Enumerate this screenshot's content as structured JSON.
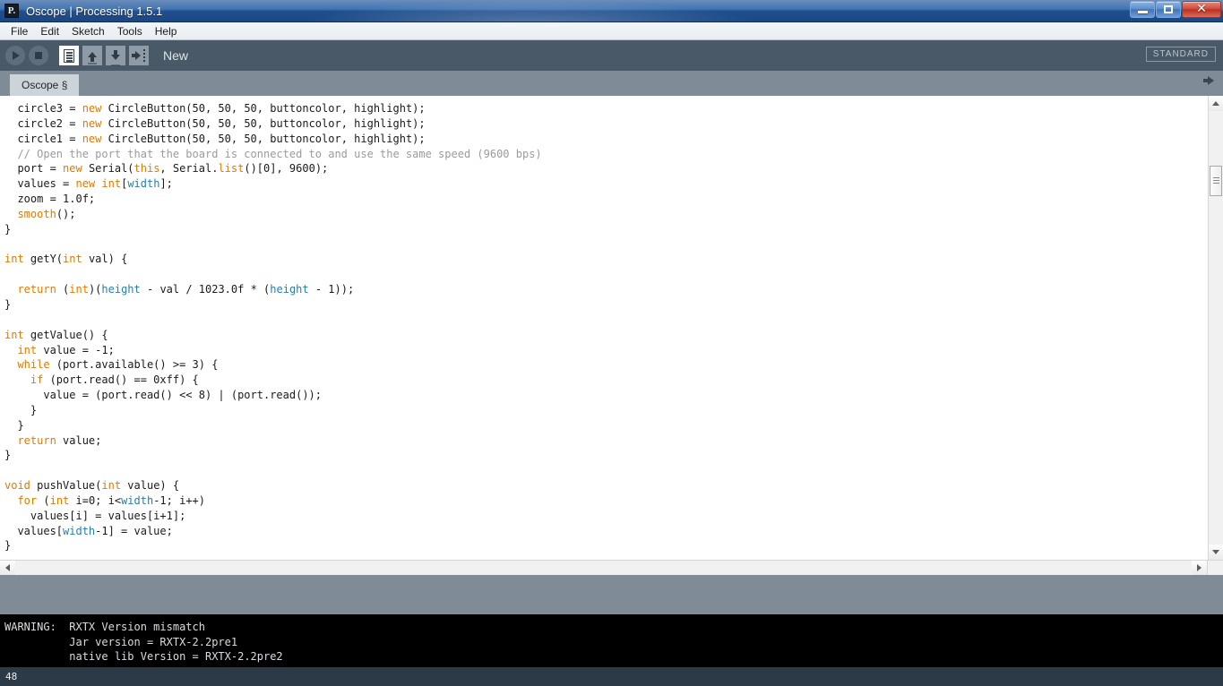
{
  "window": {
    "title": "Oscope | Processing 1.5.1",
    "app_icon": "P.",
    "minimize_label": "Minimize",
    "maximize_label": "Restore",
    "close_label": "✕"
  },
  "menubar": {
    "items": [
      {
        "label": "File"
      },
      {
        "label": "Edit"
      },
      {
        "label": "Sketch"
      },
      {
        "label": "Tools"
      },
      {
        "label": "Help"
      }
    ]
  },
  "toolbar": {
    "run_label": "Run",
    "stop_label": "Stop",
    "new_label": "New",
    "open_label": "Open",
    "save_label": "Save",
    "export_label": "Export",
    "status_text": "New",
    "mode_label": "STANDARD"
  },
  "tabbar": {
    "tabs": [
      {
        "label": "Oscope §"
      }
    ],
    "overflow_label": "More tabs"
  },
  "editor": {
    "lines": [
      [
        {
          "t": "  circle3 = ",
          "c": "lit"
        },
        {
          "t": "new",
          "c": "kw"
        },
        {
          "t": " CircleButton(50, 50, 50, buttoncolor, highlight);",
          "c": "lit"
        }
      ],
      [
        {
          "t": "  circle2 = ",
          "c": "lit"
        },
        {
          "t": "new",
          "c": "kw"
        },
        {
          "t": " CircleButton(50, 50, 50, buttoncolor, highlight);",
          "c": "lit"
        }
      ],
      [
        {
          "t": "  circle1 = ",
          "c": "lit"
        },
        {
          "t": "new",
          "c": "kw"
        },
        {
          "t": " CircleButton(50, 50, 50, buttoncolor, highlight);",
          "c": "lit"
        }
      ],
      [
        {
          "t": "  // Open the port that the board is connected to and use the same speed (9600 bps)",
          "c": "cm"
        }
      ],
      [
        {
          "t": "  port = ",
          "c": "lit"
        },
        {
          "t": "new",
          "c": "kw"
        },
        {
          "t": " Serial(",
          "c": "lit"
        },
        {
          "t": "this",
          "c": "kw"
        },
        {
          "t": ", Serial.",
          "c": "lit"
        },
        {
          "t": "list",
          "c": "fn"
        },
        {
          "t": "()[0], 9600);",
          "c": "lit"
        }
      ],
      [
        {
          "t": "  values = ",
          "c": "lit"
        },
        {
          "t": "new",
          "c": "kw"
        },
        {
          "t": " ",
          "c": "lit"
        },
        {
          "t": "int",
          "c": "kw"
        },
        {
          "t": "[",
          "c": "lit"
        },
        {
          "t": "width",
          "c": "var"
        },
        {
          "t": "];",
          "c": "lit"
        }
      ],
      [
        {
          "t": "  zoom = 1.0f;",
          "c": "lit"
        }
      ],
      [
        {
          "t": "  ",
          "c": "lit"
        },
        {
          "t": "smooth",
          "c": "fn"
        },
        {
          "t": "();",
          "c": "lit"
        }
      ],
      [
        {
          "t": "}",
          "c": "lit"
        }
      ],
      [
        {
          "t": "",
          "c": "lit"
        }
      ],
      [
        {
          "t": "int",
          "c": "kw"
        },
        {
          "t": " getY(",
          "c": "lit"
        },
        {
          "t": "int",
          "c": "kw"
        },
        {
          "t": " val) {",
          "c": "lit"
        }
      ],
      [
        {
          "t": "",
          "c": "lit"
        }
      ],
      [
        {
          "t": "  ",
          "c": "lit"
        },
        {
          "t": "return",
          "c": "kw"
        },
        {
          "t": " (",
          "c": "lit"
        },
        {
          "t": "int",
          "c": "kw"
        },
        {
          "t": ")(",
          "c": "lit"
        },
        {
          "t": "height",
          "c": "var"
        },
        {
          "t": " - val / 1023.0f * (",
          "c": "lit"
        },
        {
          "t": "height",
          "c": "var"
        },
        {
          "t": " - 1));",
          "c": "lit"
        }
      ],
      [
        {
          "t": "}",
          "c": "lit"
        }
      ],
      [
        {
          "t": "",
          "c": "lit"
        }
      ],
      [
        {
          "t": "int",
          "c": "kw"
        },
        {
          "t": " getValue() {",
          "c": "lit"
        }
      ],
      [
        {
          "t": "  ",
          "c": "lit"
        },
        {
          "t": "int",
          "c": "kw"
        },
        {
          "t": " value = -1;",
          "c": "lit"
        }
      ],
      [
        {
          "t": "  ",
          "c": "lit"
        },
        {
          "t": "while",
          "c": "kw"
        },
        {
          "t": " (port.available() >= 3) {",
          "c": "lit"
        }
      ],
      [
        {
          "t": "    ",
          "c": "lit"
        },
        {
          "t": "if",
          "c": "kw"
        },
        {
          "t": " (port.read() == 0xff) {",
          "c": "lit"
        }
      ],
      [
        {
          "t": "      value = (port.read() << 8) | (port.read());",
          "c": "lit"
        }
      ],
      [
        {
          "t": "    }",
          "c": "lit"
        }
      ],
      [
        {
          "t": "  }",
          "c": "lit"
        }
      ],
      [
        {
          "t": "  ",
          "c": "lit"
        },
        {
          "t": "return",
          "c": "kw"
        },
        {
          "t": " value;",
          "c": "lit"
        }
      ],
      [
        {
          "t": "}",
          "c": "lit"
        }
      ],
      [
        {
          "t": "",
          "c": "lit"
        }
      ],
      [
        {
          "t": "void",
          "c": "kw"
        },
        {
          "t": " pushValue(",
          "c": "lit"
        },
        {
          "t": "int",
          "c": "kw"
        },
        {
          "t": " value) {",
          "c": "lit"
        }
      ],
      [
        {
          "t": "  ",
          "c": "lit"
        },
        {
          "t": "for",
          "c": "kw"
        },
        {
          "t": " (",
          "c": "lit"
        },
        {
          "t": "int",
          "c": "kw"
        },
        {
          "t": " i=0; i<",
          "c": "lit"
        },
        {
          "t": "width",
          "c": "var"
        },
        {
          "t": "-1; i++)",
          "c": "lit"
        }
      ],
      [
        {
          "t": "    values[i] = values[i+1];",
          "c": "lit"
        }
      ],
      [
        {
          "t": "  values[",
          "c": "lit"
        },
        {
          "t": "width",
          "c": "var"
        },
        {
          "t": "-1] = value;",
          "c": "lit"
        }
      ],
      [
        {
          "t": "}",
          "c": "lit"
        }
      ]
    ]
  },
  "console": {
    "lines": [
      "WARNING:  RXTX Version mismatch",
      "          Jar version = RXTX-2.2pre1",
      "          native lib Version = RXTX-2.2pre2"
    ]
  },
  "statusbar": {
    "line_number": "48"
  },
  "colors": {
    "keyword": "#e07b00",
    "comment": "#9b9b9b",
    "variable": "#2a7da8",
    "text": "#1a1a1a",
    "toolbar_bg": "#4a5968",
    "tabbar_bg": "#7f8b97",
    "console_bg": "#000000",
    "statusbar_bg": "#2c3947"
  }
}
